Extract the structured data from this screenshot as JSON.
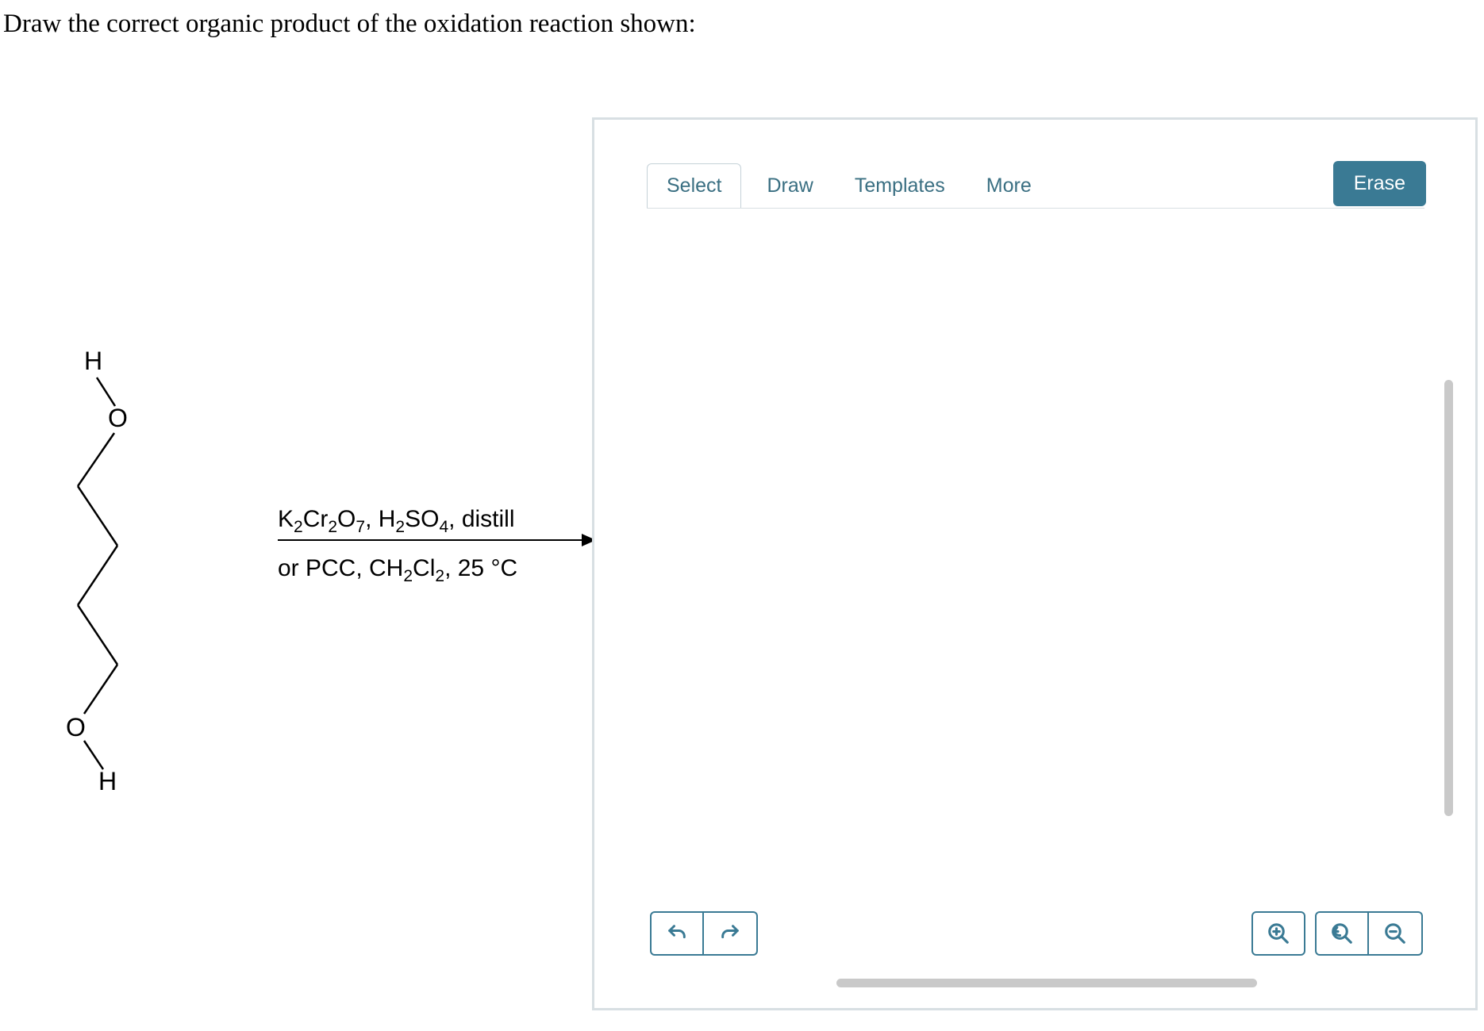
{
  "question": {
    "prompt": "Draw the correct organic product of the oxidation reaction shown:"
  },
  "reaction": {
    "reagent_line1_html": "K<sub>2</sub>Cr<sub>2</sub>O<sub>7</sub>, H<sub>2</sub>SO<sub>4</sub>, distill",
    "reagent_line2_html": "or PCC, CH<sub>2</sub>Cl<sub>2</sub>, 25 °C",
    "starting_material": {
      "atoms": [
        "H",
        "O",
        "O",
        "H"
      ],
      "description": "1,4-butanediol zigzag structure"
    }
  },
  "toolbar": {
    "select_label": "Select",
    "draw_label": "Draw",
    "templates_label": "Templates",
    "more_label": "More",
    "erase_label": "Erase"
  },
  "controls": {
    "undo_icon": "undo",
    "redo_icon": "redo",
    "zoom_in_icon": "zoom-in",
    "zoom_reset_icon": "zoom-reset",
    "zoom_out_icon": "zoom-out"
  }
}
